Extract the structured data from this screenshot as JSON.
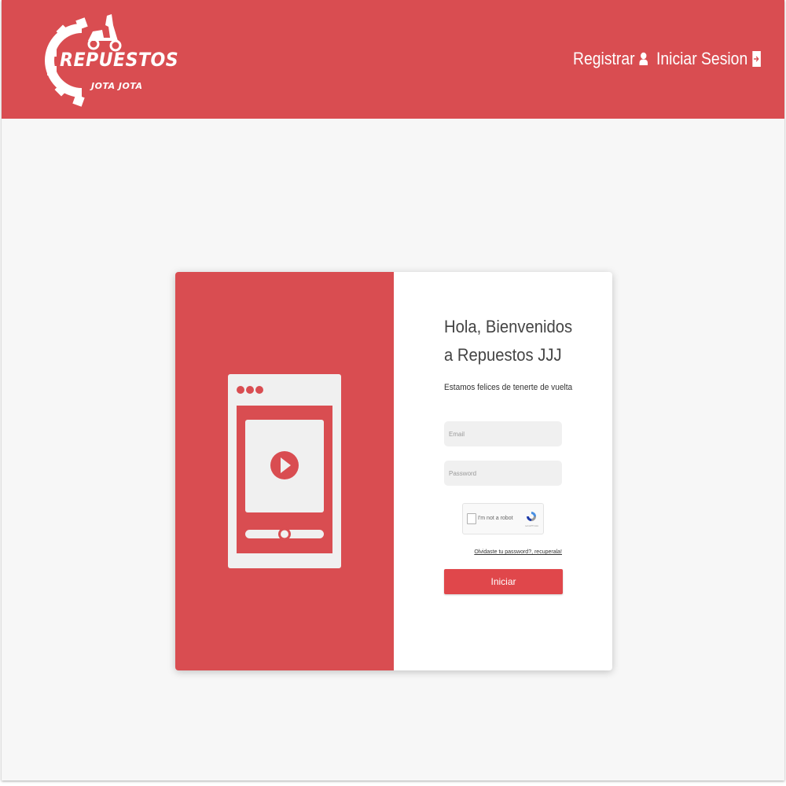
{
  "brand": {
    "logo_text_main": "REPUESTOS",
    "logo_text_sub": "JOTA JOTA",
    "color_primary": "#d94d51",
    "color_button": "#e0474b"
  },
  "nav": {
    "register_label": "Registrar",
    "register_icon": "user-icon",
    "login_label": "Iniciar Sesion",
    "login_icon": "sign-in-icon"
  },
  "login": {
    "title": "Hola, Bienvenidos a Repuestos JJJ",
    "subtitle": "Estamos felices de tenerte de vuelta",
    "email_placeholder": "Email",
    "email_value": "",
    "password_placeholder": "Password",
    "password_value": "",
    "captcha_label": "I'm not a robot",
    "captcha_terms": "reCAPTCHA",
    "forgot_link": "Olvidaste tu password?, recuperala!",
    "submit_label": "Iniciar"
  },
  "illustration": {
    "icon": "video-player-icon"
  }
}
